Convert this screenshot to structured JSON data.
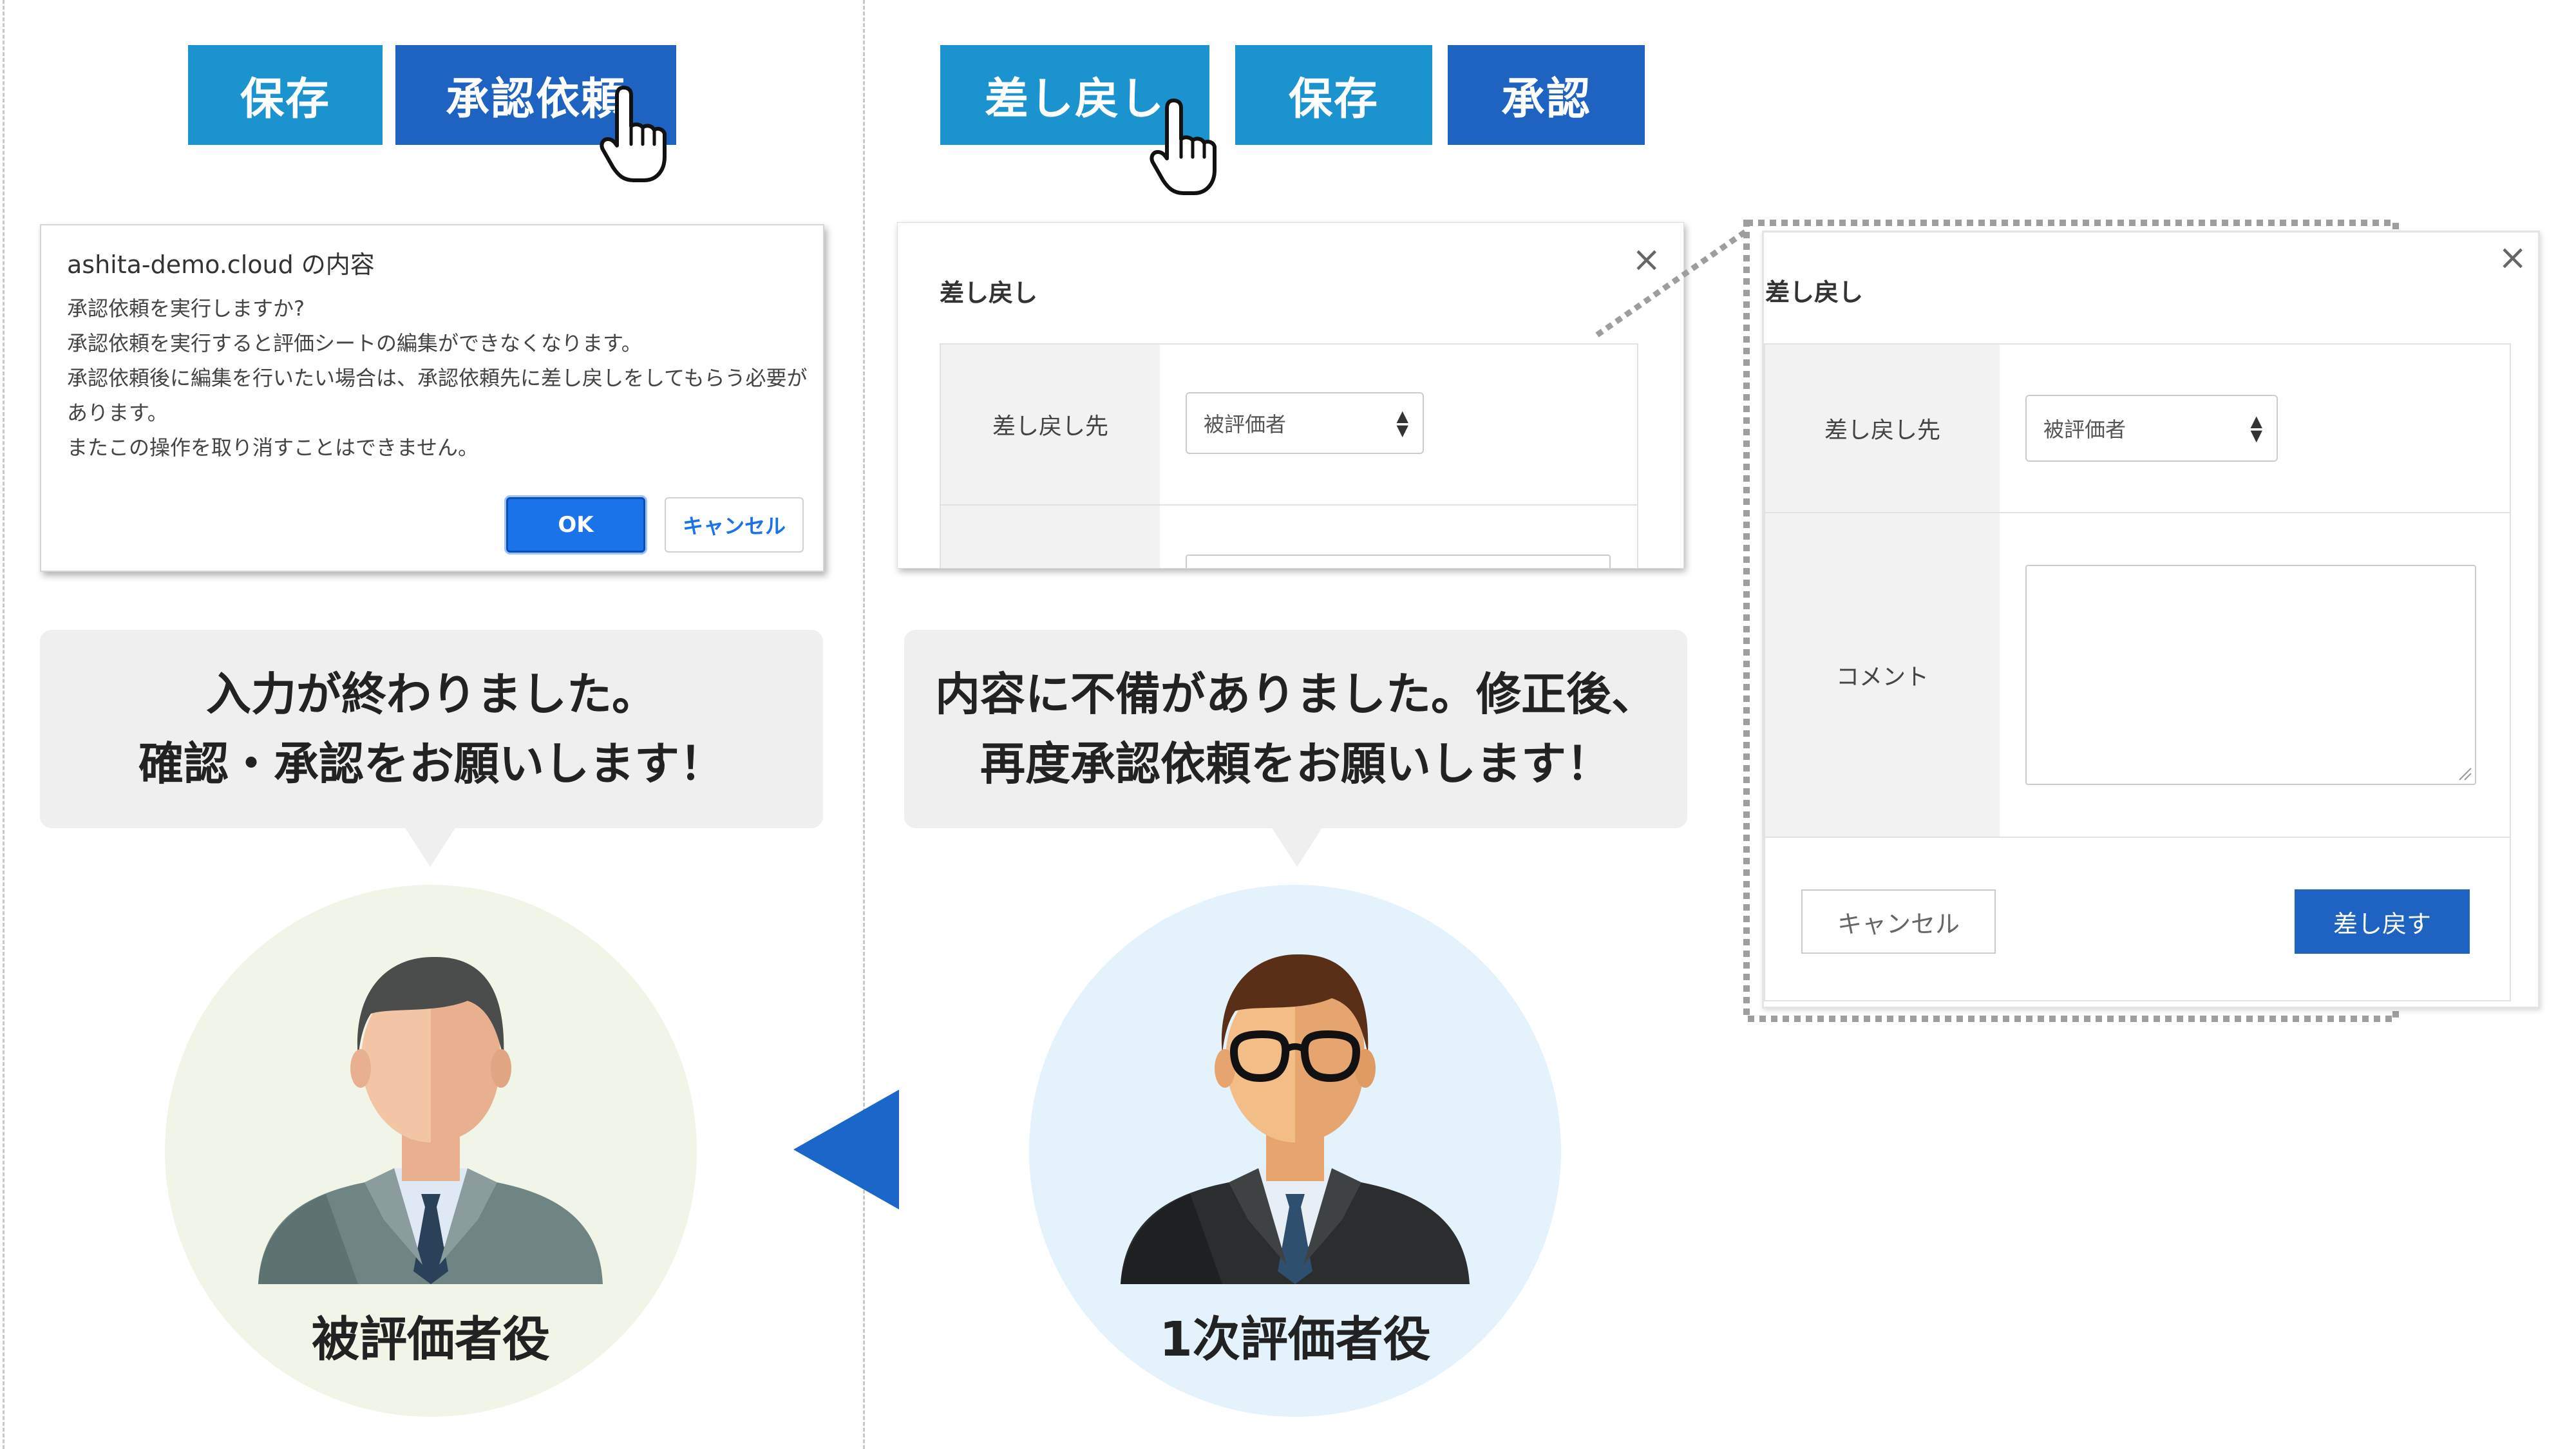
{
  "left_panel": {
    "buttons": {
      "save": "保存",
      "request_approval": "承認依頼"
    },
    "confirm_dialog": {
      "title": "ashita-demo.cloud の内容",
      "lines": [
        "承認依頼を実行しますか?",
        "承認依頼を実行すると評価シートの編集ができなくなります。",
        "承認依頼後に編集を行いたい場合は、承認依頼先に差し戻しをしてもらう必要が",
        "あります。",
        "またこの操作を取り消すことはできません。"
      ],
      "ok": "OK",
      "cancel": "キャンセル"
    },
    "bubble": {
      "line1": "入力が終わりました。",
      "line2": "確認・承認をお願いします！"
    },
    "role": "被評価者役"
  },
  "right_panel": {
    "buttons": {
      "send_back": "差し戻し",
      "save": "保存",
      "approve": "承認"
    },
    "modal_small": {
      "title": "差し戻し",
      "close": "×",
      "label_target": "差し戻し先",
      "select_value": "被評価者"
    },
    "bubble": {
      "line1": "内容に不備がありました。修正後、",
      "line2": "再度承認依頼をお願いします！"
    },
    "role": "1次評価者役"
  },
  "modal_large": {
    "title": "差し戻し",
    "close": "×",
    "label_target": "差し戻し先",
    "select_value": "被評価者",
    "label_comment": "コメント",
    "cancel": "キャンセル",
    "submit": "差し戻す"
  },
  "colors": {
    "button_light": "#1b93cf",
    "button_dark": "#1f63c2",
    "arrow": "#1a66c9",
    "circle_left": "#f1f5e8",
    "circle_right": "#e3f2fb",
    "bubble": "#efefef"
  },
  "icons": {
    "cursor": "hand-pointer-icon",
    "arrow": "left-triangle-arrow-icon",
    "avatar_left": "businessman-avatar-icon",
    "avatar_right": "businessman-glasses-avatar-icon"
  }
}
